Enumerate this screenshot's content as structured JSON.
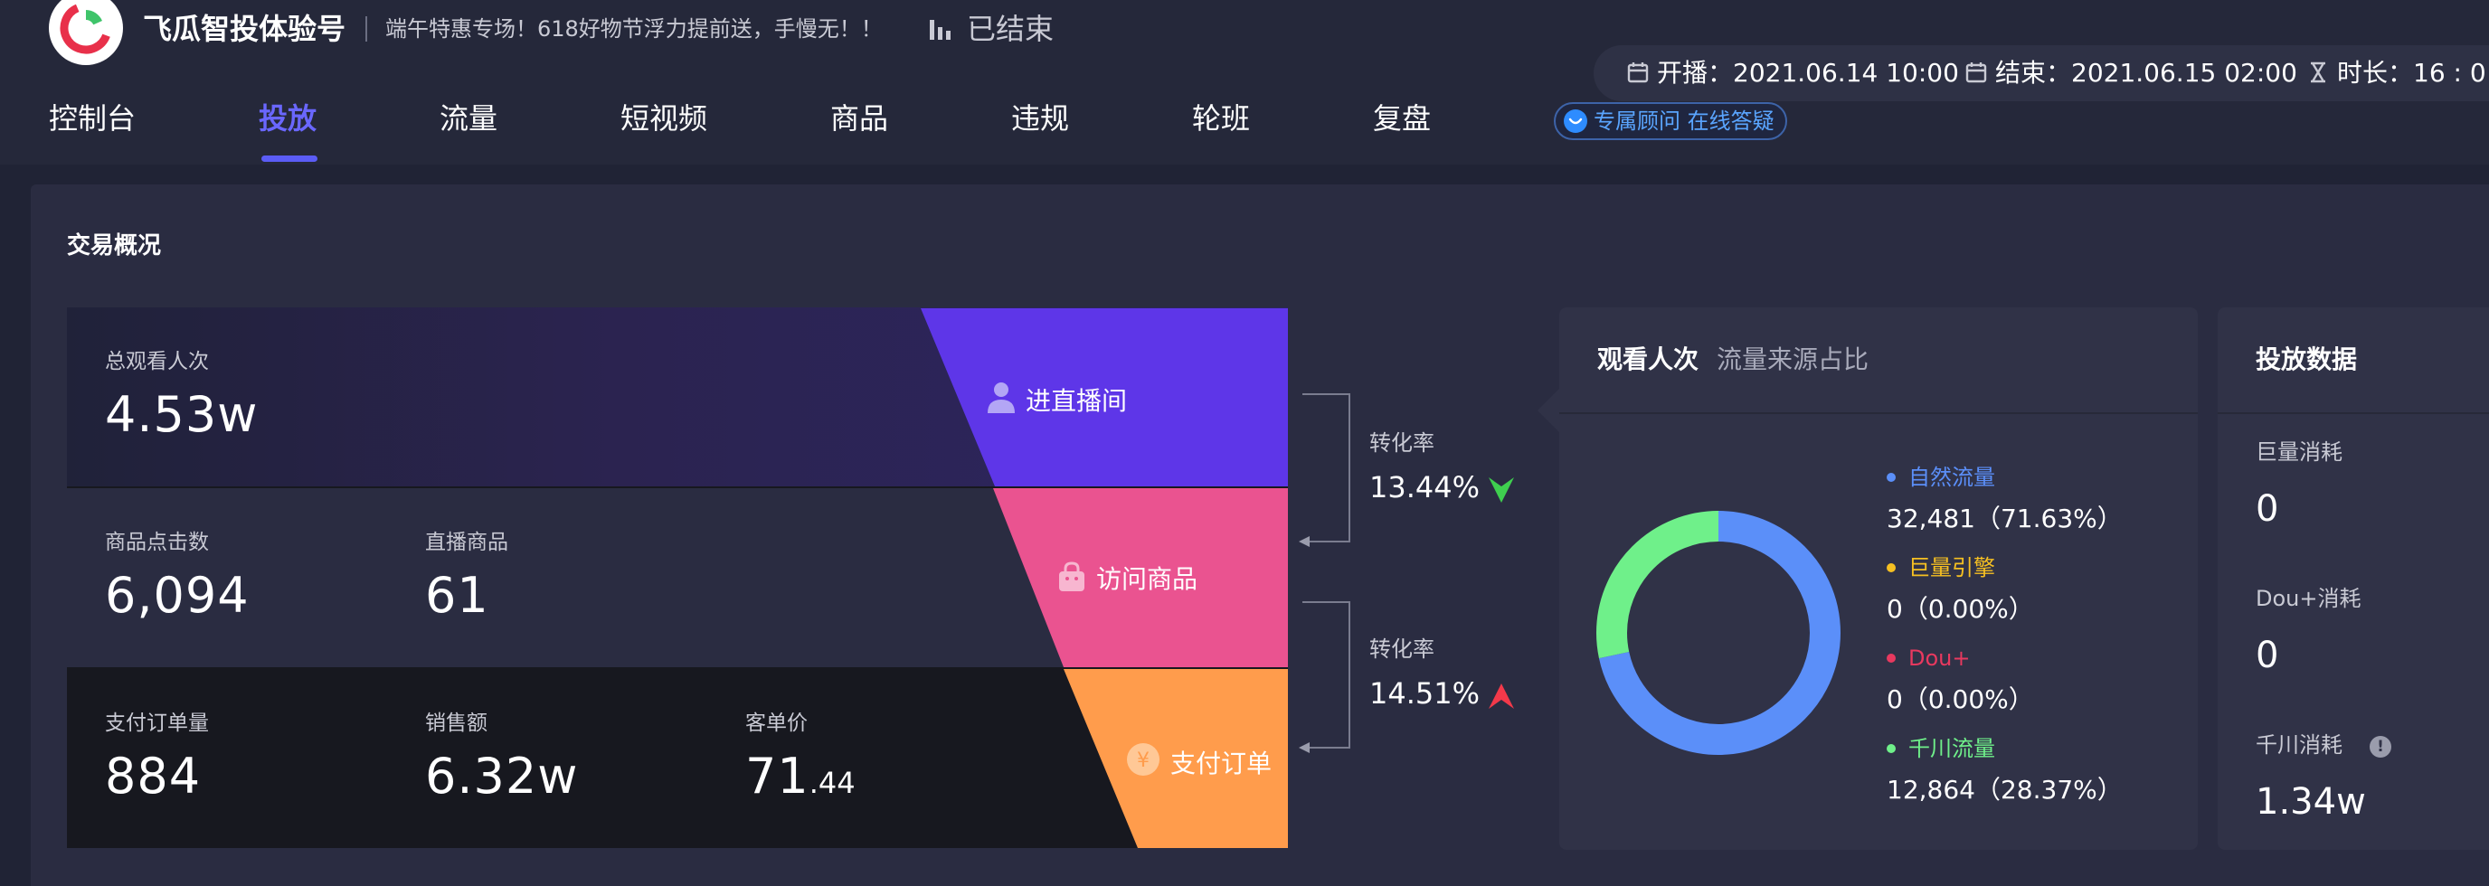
{
  "header": {
    "account_name": "飞瓜智投体验号",
    "slogan": "端午特惠专场！618好物节浮力提前送，手慢无！！",
    "status": "已结束",
    "start": "开播：2021.06.14 10:00",
    "end": "结束：2021.06.15 02:00",
    "duration": "时长：16 : 0",
    "consult": "专属顾问 在线答疑"
  },
  "tabs": [
    "控制台",
    "投放",
    "流量",
    "短视频",
    "商品",
    "违规",
    "轮班",
    "复盘"
  ],
  "active_tab": "投放",
  "overview": {
    "title": "交易概况",
    "total_views": {
      "label": "总观看人次",
      "value": "4.53w"
    },
    "product_clicks": {
      "label": "商品点击数",
      "value": "6,094"
    },
    "live_products": {
      "label": "直播商品",
      "value": "61"
    },
    "paid_orders": {
      "label": "支付订单量",
      "value": "884"
    },
    "sales": {
      "label": "销售额",
      "value": "6.32w"
    },
    "unit_price": {
      "label": "客单价",
      "value_int": "71",
      "value_dec": ".44"
    },
    "funnel": {
      "enter": "进直播间",
      "visit": "访问商品",
      "pay": "支付订单"
    },
    "conversion1": {
      "label": "转化率",
      "value": "13.44%",
      "trend": "down"
    },
    "conversion2": {
      "label": "转化率",
      "value": "14.51%",
      "trend": "up"
    }
  },
  "traffic_source": {
    "title": "观看人次",
    "subtitle": "流量来源占比",
    "items": [
      {
        "name": "自然流量",
        "value": "32,481（71.63%）",
        "color": "#5b8ff9",
        "share": 0.7163
      },
      {
        "name": "巨量引擎",
        "value": "0（0.00%）",
        "color": "#f6c022",
        "share": 0
      },
      {
        "name": "Dou+",
        "value": "0（0.00%）",
        "color": "#e8395f",
        "share": 0
      },
      {
        "name": "千川流量",
        "value": "12,864（28.37%）",
        "color": "#6ff08a",
        "share": 0.2837
      }
    ]
  },
  "ad_data": {
    "title": "投放数据",
    "items": [
      {
        "label": "巨量消耗",
        "value": "0"
      },
      {
        "label": "Dou+消耗",
        "value": "0"
      },
      {
        "label": "千川消耗",
        "value": "1.34w"
      }
    ]
  },
  "colors": {
    "accent": "#6a67ff",
    "enter": "#5e36e8",
    "visit": "#ea5390",
    "pay": "#ff9c4c",
    "down": "#3fcf4f",
    "up": "#f3394a"
  }
}
